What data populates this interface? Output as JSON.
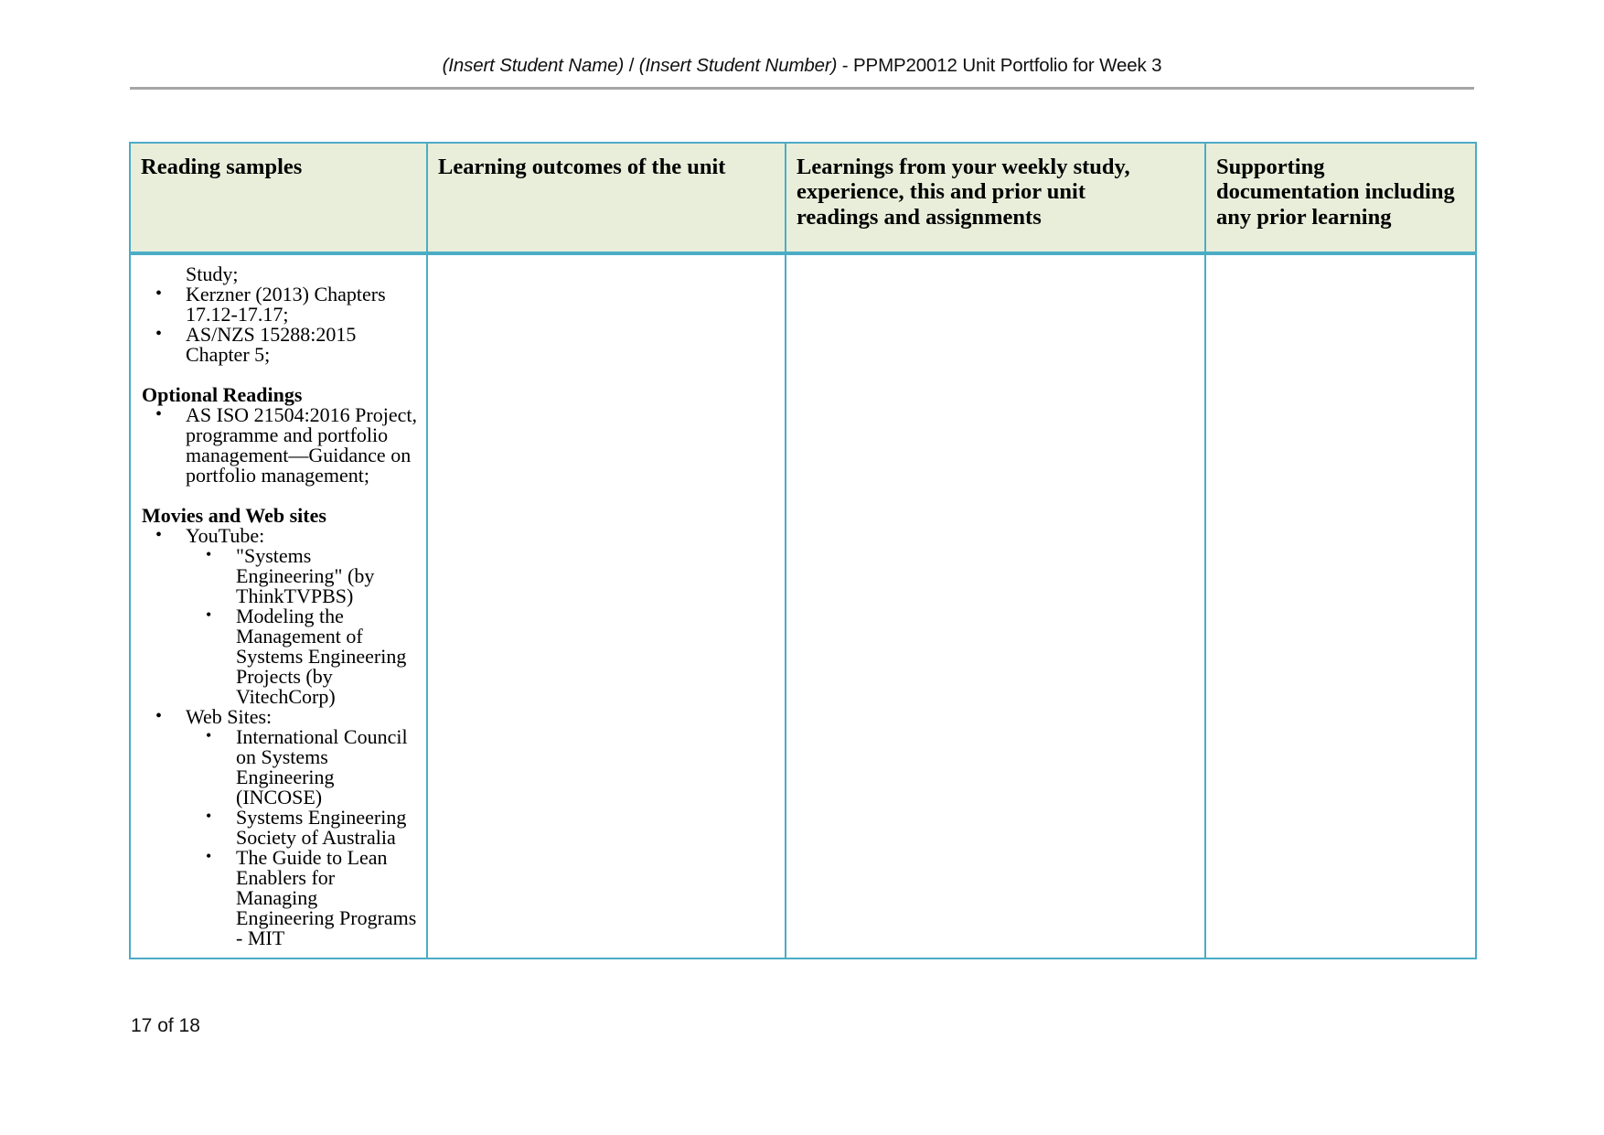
{
  "document": {
    "header": {
      "student_name_placeholder": "(Insert Student Name)",
      "separator": " / ",
      "student_number_placeholder": "(Insert Student Number)",
      "suffix": " - PPMP20012 Unit Portfolio for Week 3",
      "full_text": "(Insert Student Name) / (Insert Student Number) - PPMP20012 Unit Portfolio for Week 3"
    },
    "footer": {
      "page_number": "17 of 18"
    },
    "colors": {
      "table_border": "#4BACC6",
      "header_fill": "#E9EEDA",
      "header_rule": "#A6A6A6",
      "text": "#000000"
    }
  },
  "table": {
    "columns": [
      {
        "header": "Reading samples"
      },
      {
        "header": "Learning outcomes of the unit"
      },
      {
        "header_lines": [
          "Learnings from your weekly study,",
          "experience, this and prior unit",
          "readings and assignments"
        ]
      },
      {
        "header_lines": [
          "Supporting",
          "documentation including",
          "any prior learning"
        ]
      }
    ],
    "header_labels": {
      "col1": "Reading samples",
      "col2": "Learning outcomes of the unit",
      "col3_line1": "Learnings from your weekly study,",
      "col3_line2": "experience, this and prior unit",
      "col3_line3": "readings and assignments",
      "col4_line1": "Supporting",
      "col4_line2": "documentation including",
      "col4_line3": "any prior learning"
    },
    "body": {
      "reading_samples": {
        "continued_line": "Study;",
        "required_items": [
          "Kerzner (2013) Chapters 17.12-17.17;",
          "AS/NZS 15288:2015 Chapter 5;"
        ],
        "optional_heading": "Optional Readings",
        "optional_items": [
          "AS ISO 21504:2016 Project, programme and portfolio management—Guidance on portfolio management;"
        ],
        "movies_heading": "Movies and Web sites",
        "groups": [
          {
            "label": "YouTube:",
            "items": [
              "\"Systems Engineering\" (by ThinkTVPBS)",
              "Modeling the Management of Systems Engineering Projects (by VitechCorp)"
            ]
          },
          {
            "label": "Web Sites:",
            "items": [
              "International Council on Systems Engineering (INCOSE)",
              "Systems Engineering Society of Australia",
              "The Guide to Lean Enablers for Managing Engineering Programs - MIT"
            ]
          }
        ]
      },
      "learning_outcomes": "",
      "learnings_from_study": "",
      "supporting_documentation": ""
    },
    "bullet_glyph": "•"
  }
}
